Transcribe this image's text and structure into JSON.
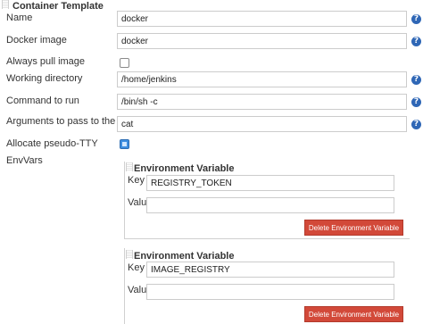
{
  "container": {
    "title": "Container Template",
    "name_label": "Name",
    "name_value": "docker",
    "image_label": "Docker image",
    "image_value": "docker",
    "always_pull_label": "Always pull image",
    "workdir_label": "Working directory",
    "workdir_value": "/home/jenkins",
    "command_label": "Command to run",
    "command_value": "/bin/sh -c",
    "args_label": "Arguments to pass to the command",
    "args_value": "cat",
    "tty_label": "Allocate pseudo-TTY",
    "envvars_label": "EnvVars"
  },
  "env_vars": [
    {
      "title": "Environment Variable",
      "key_label": "Key",
      "key_value": "REGISTRY_TOKEN",
      "value_label": "Value",
      "value_value": "",
      "delete_label": "Delete Environment Variable"
    },
    {
      "title": "Environment Variable",
      "key_label": "Key",
      "key_value": "IMAGE_REGISTRY",
      "value_label": "Value",
      "value_value": "",
      "delete_label": "Delete Environment Variable"
    }
  ],
  "help_glyph": "?",
  "colors": {
    "help_icon": "#2f67b6",
    "delete_button": "#d24939",
    "checkbox_checked": "#3d8ee0"
  }
}
